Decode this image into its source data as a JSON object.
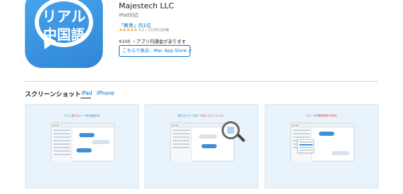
{
  "app_icon": {
    "line1": "リアル",
    "line2": "中国語",
    "color": "#3b95e2"
  },
  "app_info": {
    "developer": "Majestech LLC",
    "platform": "iPad対応",
    "rank": "「教育」内1位",
    "stars": "★★★★★",
    "rating": "4.2 • 172件の評価",
    "price": "¥100 ・アプリ内課金があります",
    "store_button": "こちらで表示：Mac App Store ↗"
  },
  "screenshots": {
    "title": "スクリーンショット",
    "tabs": [
      {
        "label": "iPad",
        "selected": true
      },
      {
        "label": "iPhone",
        "selected": false
      }
    ],
    "cards": [
      {
        "caption_pre": "すぐに",
        "caption_mid": "使える",
        "caption_post": "シーン別 会話形式",
        "footnote1": "",
        "footnote2": ""
      },
      {
        "caption_pre": "覚えるフレーズは",
        "caption_mid": "「お気に入りフォルダ」",
        "caption_post": "",
        "footnote1": "",
        "footnote2": ""
      },
      {
        "caption_pre": "フレーズの",
        "caption_mid": "関連単語も同時に",
        "caption_post": "",
        "footnote1": "",
        "footnote2": ""
      }
    ]
  }
}
